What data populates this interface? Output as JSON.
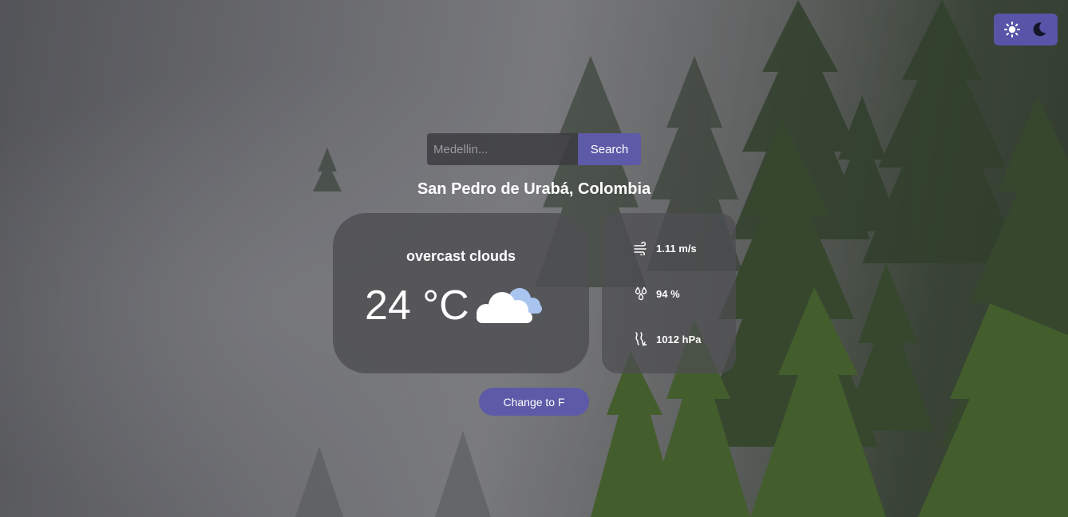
{
  "theme_toggle": {
    "light_icon": "sun-icon",
    "dark_icon": "moon-icon",
    "bg_color": "#5855a8"
  },
  "search": {
    "placeholder": "Medellin...",
    "value": "",
    "button_label": "Search",
    "accent": "#5d5aa8"
  },
  "location": "San Pedro de Urabá, Colombia",
  "weather": {
    "condition": "overcast clouds",
    "temperature": "24 °C",
    "icon": "overcast-clouds-icon"
  },
  "details": {
    "wind": {
      "icon": "wind-icon",
      "value": "1.11 m/s"
    },
    "humidity": {
      "icon": "humidity-icon",
      "value": "94 %"
    },
    "pressure": {
      "icon": "pressure-icon",
      "value": "1012 hPa"
    }
  },
  "unit_toggle_label": "Change to F"
}
